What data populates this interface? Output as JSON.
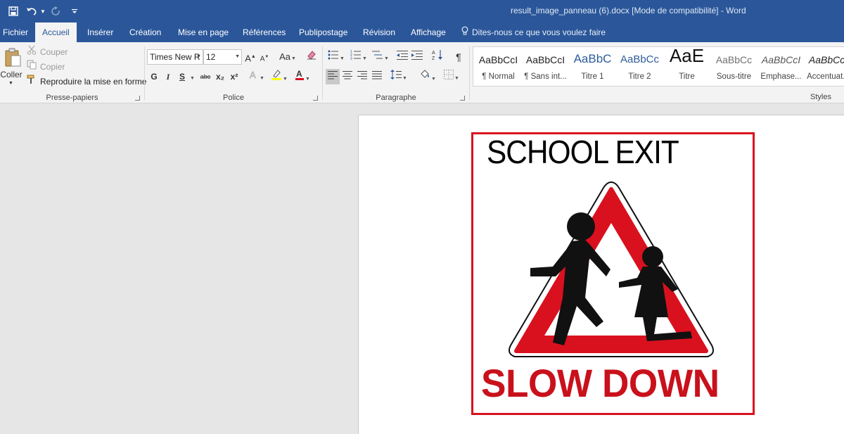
{
  "window": {
    "title": "result_image_panneau (6).docx [Mode de compatibilité]  -  Word"
  },
  "tabs": [
    {
      "label": "Fichier",
      "active": false
    },
    {
      "label": "Accueil",
      "active": true
    },
    {
      "label": "Insérer",
      "active": false
    },
    {
      "label": "Création",
      "active": false
    },
    {
      "label": "Mise en page",
      "active": false
    },
    {
      "label": "Références",
      "active": false
    },
    {
      "label": "Publipostage",
      "active": false
    },
    {
      "label": "Révision",
      "active": false
    },
    {
      "label": "Affichage",
      "active": false
    }
  ],
  "tellme": {
    "label": "Dites-nous ce que vous voulez faire"
  },
  "clipboard": {
    "paste": "Coller",
    "cut": "Couper",
    "copy": "Copier",
    "format_painter": "Reproduire la mise en forme",
    "group_label": "Presse-papiers"
  },
  "font": {
    "name": "Times New R",
    "size": "12",
    "group_label": "Police",
    "bold": "G",
    "italic": "I",
    "underline": "S",
    "strike": "abc",
    "grow": "A",
    "shrink": "A",
    "case": "Aa",
    "sub": "x₂",
    "sup": "x²",
    "highlight_color": "#ffff00",
    "font_color": "#d9111f"
  },
  "paragraph": {
    "group_label": "Paragraphe"
  },
  "styles": {
    "group_label": "Styles",
    "items": [
      {
        "sample": "AaBbCcI",
        "name": "¶ Normal"
      },
      {
        "sample": "AaBbCcI",
        "name": "¶ Sans int..."
      },
      {
        "sample": "AaBbC",
        "name": "Titre 1"
      },
      {
        "sample": "AaBbCc",
        "name": "Titre 2"
      },
      {
        "sample": "AaE",
        "name": "Titre"
      },
      {
        "sample": "AaBbCc",
        "name": "Sous-titre"
      },
      {
        "sample": "AaBbCcI",
        "name": "Emphase..."
      },
      {
        "sample": "AaBbCcI",
        "name": "Accentuat..."
      }
    ]
  },
  "document": {
    "sign_top": "SCHOOL EXIT",
    "sign_bottom": "SLOW DOWN",
    "sign_red": "#d9111f"
  }
}
